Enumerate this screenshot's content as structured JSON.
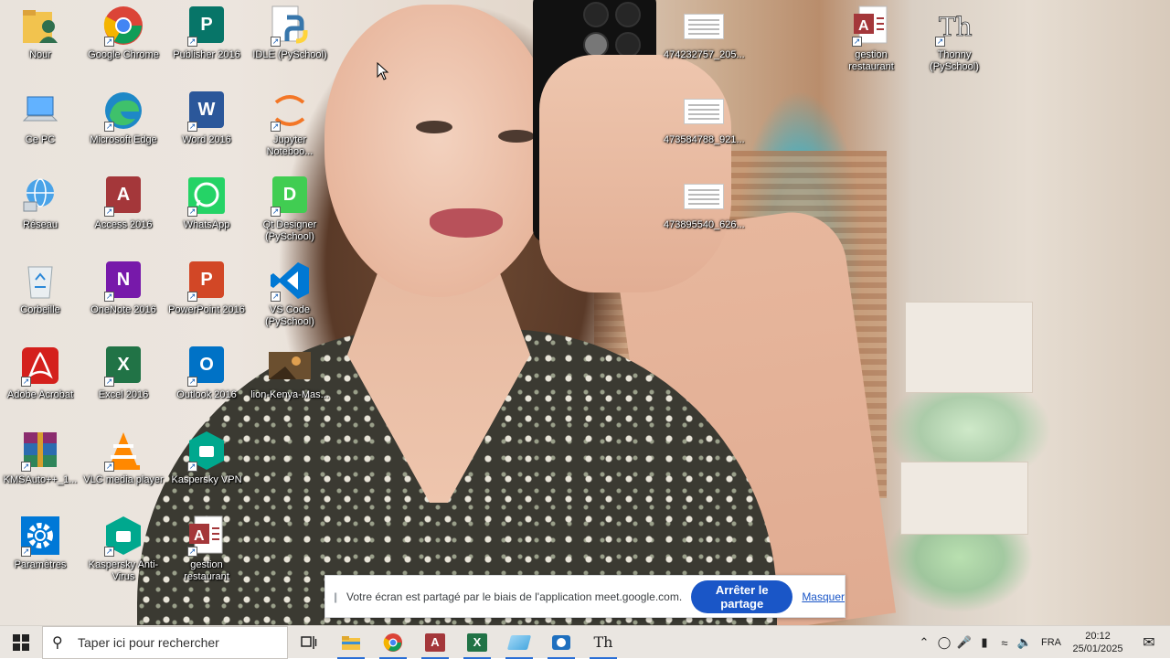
{
  "desktop": {
    "icons": [
      {
        "label": "Nour",
        "icon": "user-folder-icon",
        "color": "#e8b84a"
      },
      {
        "label": "Google Chrome",
        "icon": "chrome-icon",
        "color": "#4285f4"
      },
      {
        "label": "Publisher 2016",
        "icon": "publisher-icon",
        "color": "#077568",
        "glyph": "P"
      },
      {
        "label": "IDLE (PySchool)",
        "icon": "python-idle-icon",
        "color": "#3776ab"
      },
      {
        "label": "Ce PC",
        "icon": "computer-icon",
        "color": "#2b88d8"
      },
      {
        "label": "Microsoft Edge",
        "icon": "edge-icon",
        "color": "#1e88c7"
      },
      {
        "label": "Word 2016",
        "icon": "word-icon",
        "color": "#2b579a",
        "glyph": "W"
      },
      {
        "label": "Jupyter Noteboo...",
        "icon": "jupyter-icon",
        "color": "#f37626"
      },
      {
        "label": "Réseau",
        "icon": "network-icon",
        "color": "#2b88d8"
      },
      {
        "label": "Access 2016",
        "icon": "access-icon",
        "color": "#a4373a",
        "glyph": "A"
      },
      {
        "label": "WhatsApp",
        "icon": "whatsapp-icon",
        "color": "#25d366"
      },
      {
        "label": "Qt Designer (PySchool)",
        "icon": "qt-designer-icon",
        "color": "#41cd52",
        "glyph": "D"
      },
      {
        "label": "Corbeille",
        "icon": "recycle-bin-icon",
        "color": "#cfd8dc"
      },
      {
        "label": "OneNote 2016",
        "icon": "onenote-icon",
        "color": "#7719aa",
        "glyph": "N"
      },
      {
        "label": "PowerPoint 2016",
        "icon": "powerpoint-icon",
        "color": "#d24726",
        "glyph": "P"
      },
      {
        "label": "VS Code (PySchool)",
        "icon": "vscode-icon",
        "color": "#0078d4"
      },
      {
        "label": "Adobe Acrobat",
        "icon": "acrobat-icon",
        "color": "#d4201c"
      },
      {
        "label": "Excel 2016",
        "icon": "excel-icon",
        "color": "#217346",
        "glyph": "X"
      },
      {
        "label": "Outlook 2016",
        "icon": "outlook-icon",
        "color": "#0072c6",
        "glyph": "O"
      },
      {
        "label": "lion-Kenya-Mas...",
        "icon": "image-file-icon",
        "color": "#6b4f2f"
      },
      {
        "label": "KMSAuto++_1...",
        "icon": "winrar-icon",
        "color": "#8b2c6e"
      },
      {
        "label": "VLC media player",
        "icon": "vlc-icon",
        "color": "#ff8800"
      },
      {
        "label": "Kaspersky VPN",
        "icon": "kaspersky-vpn-icon",
        "color": "#00a88e"
      },
      {
        "label": "Paramètres",
        "icon": "settings-gear-icon",
        "color": "#0078d7"
      },
      {
        "label": "Kaspersky Anti-Virus",
        "icon": "kaspersky-antivirus-icon",
        "color": "#00a88e"
      },
      {
        "label": "gestion restaurant",
        "icon": "access-db-file-icon",
        "color": "#a4373a",
        "glyph": "A"
      },
      {
        "label": "474232757_205...",
        "icon": "document-thumbnail-icon"
      },
      {
        "label": "473584788_921...",
        "icon": "document-thumbnail-icon"
      },
      {
        "label": "473895540_626...",
        "icon": "document-thumbnail-icon"
      },
      {
        "label": "gestion restaurant",
        "icon": "access-db-file-icon",
        "color": "#a4373a",
        "glyph": "A"
      },
      {
        "label": "Thonny (PySchool)",
        "icon": "thonny-icon",
        "color": "#ffffff",
        "glyph": "Th"
      }
    ]
  },
  "share_bar": {
    "message": "Votre écran est partagé par le biais de l'application meet.google.com.",
    "stop_label": "Arrêter le partage",
    "hide_label": "Masquer"
  },
  "taskbar": {
    "search_placeholder": "Taper ici pour rechercher",
    "pinned": [
      "task-view-icon",
      "file-explorer-icon",
      "chrome-icon",
      "access-icon",
      "excel-icon",
      "azure-data-icon",
      "screen-capture-icon",
      "thonny-icon"
    ],
    "language": "FRA",
    "time": "20:12",
    "date": "25/01/2025"
  }
}
